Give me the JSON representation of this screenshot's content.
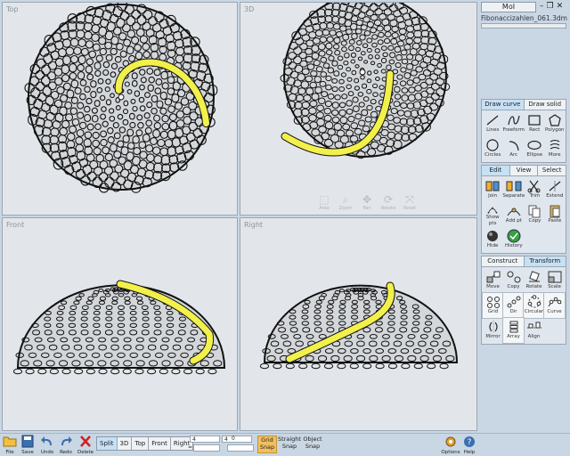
{
  "viewports": {
    "top": "Top",
    "three_d": "3D",
    "front": "Front",
    "right": "Right",
    "nav_tools": [
      {
        "label": "Area",
        "icon": "zoom-area-icon"
      },
      {
        "label": "Zoom",
        "icon": "zoom-icon"
      },
      {
        "label": "Pan",
        "icon": "pan-icon"
      },
      {
        "label": "Rotate",
        "icon": "rotate-view-icon"
      },
      {
        "label": "Reset",
        "icon": "reset-view-icon"
      }
    ]
  },
  "panel": {
    "brand": "MoI",
    "filename": "Fibonaccizahlen_061.3dm",
    "draw": {
      "tabs": [
        "Draw curve",
        "Draw solid"
      ],
      "items": [
        "Lines",
        "Freeform",
        "Rect",
        "Polygon",
        "Circles",
        "Arc",
        "Ellipse",
        "More"
      ]
    },
    "edit": {
      "tabs": [
        "Edit",
        "View",
        "Select"
      ],
      "items": [
        "Join",
        "Separate",
        "Trim",
        "Extend",
        "Show pts",
        "Add pt",
        "Copy",
        "Paste",
        "Hide",
        "History"
      ]
    },
    "construct": {
      "tabs": [
        "Construct",
        "Transform"
      ],
      "items": [
        "Move",
        "Copy",
        "Rotate",
        "Scale",
        "Grid",
        "Dir",
        "Circular",
        "Curve",
        "Mirror",
        "Array",
        "Align"
      ]
    }
  },
  "bottom": {
    "file": "File",
    "save": "Save",
    "undo": "Undo",
    "redo": "Redo",
    "delete": "Delete",
    "views": [
      "Split",
      "3D",
      "Top",
      "Front",
      "Right"
    ],
    "coords": {
      "x": "4",
      "y": "4",
      "z": "0",
      "eq": "="
    },
    "grid_snap": [
      "Grid",
      "Snap"
    ],
    "straight_snap": [
      "Straight",
      "Snap"
    ],
    "object_snap": [
      "Object",
      "Snap"
    ],
    "options": "Options",
    "help": "Help"
  },
  "colors": {
    "highlight": "#f2f04a",
    "mesh": "#111111",
    "accent": "#c6e0f5"
  }
}
